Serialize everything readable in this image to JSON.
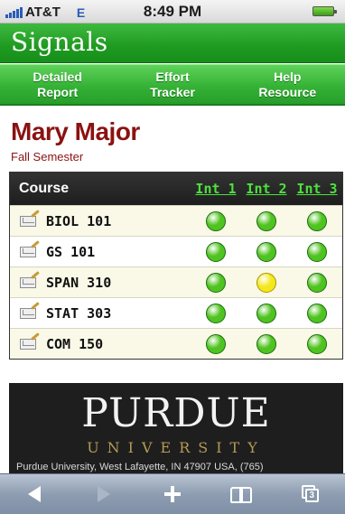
{
  "status_bar": {
    "carrier": "AT&T",
    "network": "E",
    "time": "8:49 PM"
  },
  "app": {
    "logo_text": "Signals"
  },
  "nav": {
    "items": [
      {
        "label": "Detailed\nReport"
      },
      {
        "label": "Effort\nTracker"
      },
      {
        "label": "Help\nResource"
      }
    ]
  },
  "student": {
    "name": "Mary Major",
    "semester": "Fall Semester"
  },
  "table": {
    "columns": {
      "course": "Course",
      "int1": "Int 1",
      "int2": "Int 2",
      "int3": "Int 3"
    },
    "rows": [
      {
        "course": "BIOL 101",
        "signals": [
          "green",
          "green",
          "green"
        ]
      },
      {
        "course": "GS 101",
        "signals": [
          "green",
          "green",
          "green"
        ]
      },
      {
        "course": "SPAN 310",
        "signals": [
          "green",
          "yellow",
          "green"
        ]
      },
      {
        "course": "STAT 303",
        "signals": [
          "green",
          "green",
          "green"
        ]
      },
      {
        "course": "COM 150",
        "signals": [
          "green",
          "green",
          "green"
        ]
      }
    ]
  },
  "footer": {
    "university_name": "PURDUE",
    "university_sub": "UNIVERSITY",
    "address": "Purdue University, West Lafayette, IN 47907 USA, (765)"
  },
  "colors": {
    "green_signal": "#4fc31f",
    "yellow_signal": "#f4e71c",
    "brand_green": "#1f9a21",
    "name_red": "#8b1212"
  },
  "toolbar": {
    "icons": [
      "back-arrow-icon",
      "forward-arrow-icon",
      "plus-icon",
      "bookmarks-icon",
      "pages-icon"
    ],
    "pages_count": "3"
  }
}
